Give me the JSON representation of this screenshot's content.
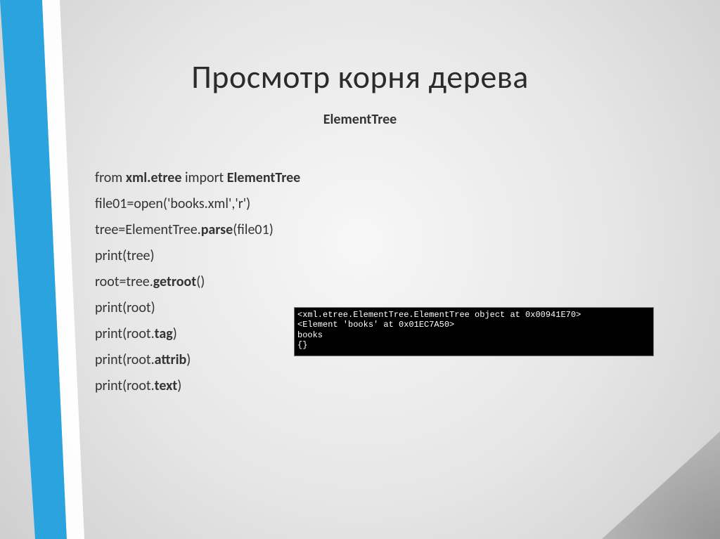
{
  "title": "Просмотр корня дерева",
  "subtitle": "ElementTree",
  "code": {
    "l1_a": "from ",
    "l1_b": "xml.etree",
    "l1_c": " import ",
    "l1_d": "ElementTree",
    "l2": "file01=open('books.xml','r')",
    "l3_a": "tree=ElementTree.",
    "l3_b": "parse",
    "l3_c": "(file01)",
    "l4": "print(tree)",
    "l5_a": "root=tree.",
    "l5_b": "getroot",
    "l5_c": "()",
    "l6": "print(root)",
    "l7_a": "print(root.",
    "l7_b": "tag",
    "l7_c": ")",
    "l8_a": "print(root.",
    "l8_b": "attrib",
    "l8_c": ")",
    "l9_a": "print(root.",
    "l9_b": "text",
    "l9_c": ")"
  },
  "terminal": "<xml.etree.ElementTree.ElementTree object at 0x00941E70>\n<Element 'books' at 0x01EC7A50>\nbooks\n{}"
}
